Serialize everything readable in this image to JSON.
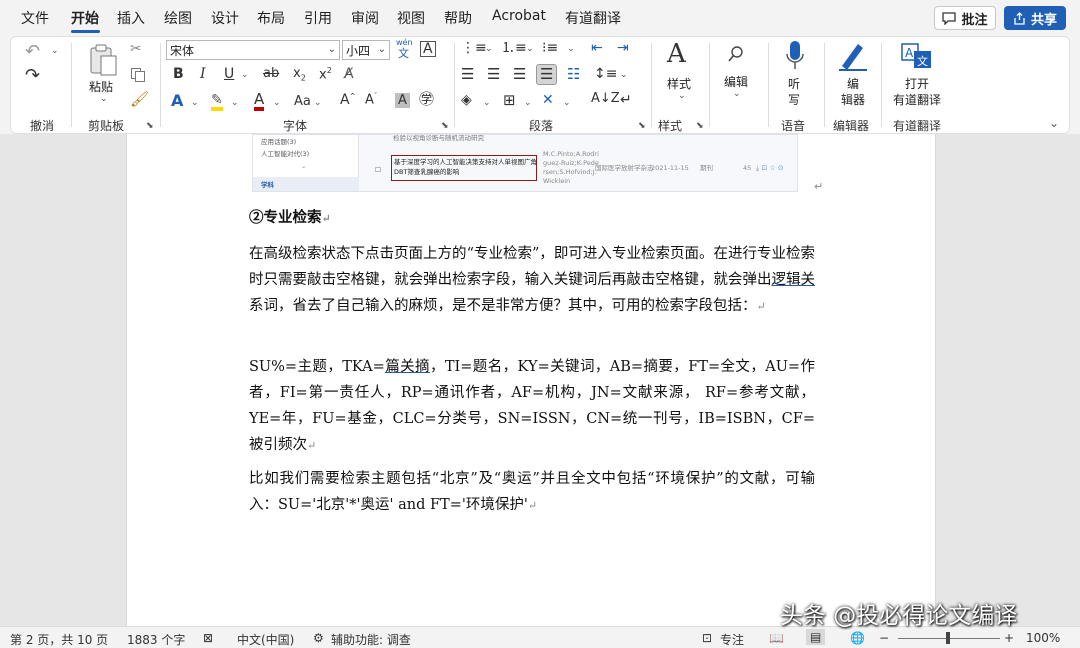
{
  "menu": {
    "tabs": [
      "文件",
      "开始",
      "插入",
      "绘图",
      "设计",
      "布局",
      "引用",
      "审阅",
      "视图",
      "帮助",
      "Acrobat",
      "有道翻译"
    ],
    "active_tab": "开始",
    "comment_button": "批注",
    "share_button": "共享"
  },
  "ribbon": {
    "groups": {
      "undo": "撤消",
      "clipboard": "剪贴板",
      "font": "字体",
      "paragraph": "段落",
      "styles": "样式",
      "voice": "语音",
      "editor": "编辑器",
      "youdao": "有道翻译"
    },
    "paste_label": "粘贴",
    "font_name": "宋体",
    "font_size": "小四",
    "wen": "wén",
    "wen_char": "文",
    "styles_label": "样式",
    "editing_label": "编辑",
    "dictate_label_1": "听",
    "dictate_label_2": "写",
    "editor_label_1": "编",
    "editor_label_2": "辑器",
    "translate_label_1": "打开",
    "translate_label_2": "有道翻译"
  },
  "embedded_image": {
    "side_items": [
      "应用话题(3)",
      "人工智能对代(3)"
    ],
    "side_label": "学科",
    "top_cut": "检验以视角诊断与随机流动研究",
    "row_title_1": "基于深度学习的人工智能决策支持对人单视图广角",
    "row_title_2": "DBT筛查乳腺癌的影响",
    "authors": [
      "M.C.Pinto;A.Rodri",
      "guez-Ruiz;K.Pede",
      "rsen;S.Hofvind;J.",
      "Wicklein"
    ],
    "source": "国际医学放射学杂志",
    "date": "2021-11-15",
    "type": "期刊",
    "count": "45"
  },
  "document": {
    "heading": "②专业检索",
    "p1_a": "在高级检索状态下点击页面上方的“专业检索”，即可进入专业检索页面。在进行专业检索时只需要敲击空格键，就会弹出检索字段，输入关键词后再敲击空格键，就会弹出",
    "p1_link": "逻辑关",
    "p1_b": "系词，省去了自己输入的麻烦，是不是非常方便？其中，可用的检索字段包括：",
    "p2_a": "SU%=主题，TKA=",
    "p2_link": "篇关摘",
    "p2_b": "，TI=题名，KY=关键词，AB=摘要，FT=全文，AU=作者，FI=第一责任人，RP=通讯作者，AF=机构，JN=文献来源， RF=参考文献，YE=年，FU=基金，CLC=分类号，SN=ISSN，CN=统一刊号，IB=ISBN，CF=被引频次",
    "p3": "比如我们需要检索主题包括“北京”及“奥运”并且全文中包括“环境保护”的文献，可输入：SU='北京'*'奥运' and FT='环境保护'",
    "mark": "↵"
  },
  "status": {
    "page": "第 2 页，共 10 页",
    "words": "1883 个字",
    "language": "中文(中国)",
    "accessibility": "辅助功能: 调查",
    "focus": "专注",
    "zoom": "100%"
  },
  "watermark": "头条 @投必得论文编译",
  "colors": {
    "accent": "#1f5fb5",
    "share_bg": "#1f5fb5",
    "link_underline": "#2a5ca8"
  }
}
